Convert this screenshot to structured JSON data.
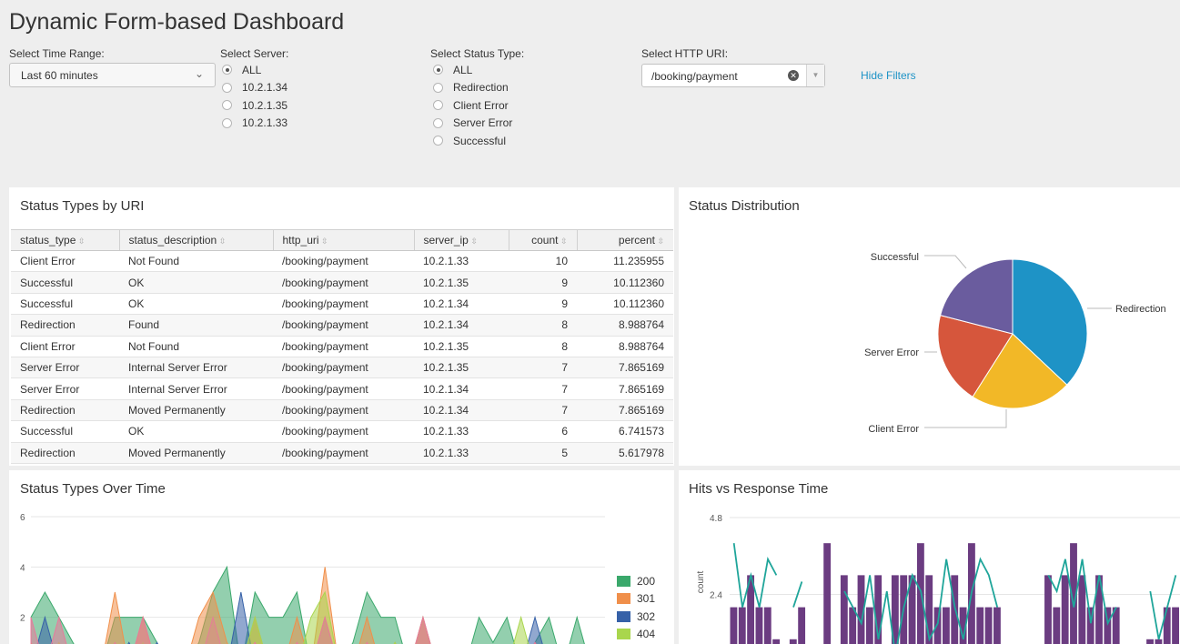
{
  "dashboard": {
    "title": "Dynamic Form-based Dashboard"
  },
  "filters": {
    "time_range": {
      "label": "Select Time Range:",
      "value": "Last 60 minutes"
    },
    "server": {
      "label": "Select Server:",
      "options": [
        "ALL",
        "10.2.1.34",
        "10.2.1.35",
        "10.2.1.33"
      ],
      "selected": 0
    },
    "status_type": {
      "label": "Select Status Type:",
      "options": [
        "ALL",
        "Redirection",
        "Client Error",
        "Server Error",
        "Successful"
      ],
      "selected": 0
    },
    "http_uri": {
      "label": "Select HTTP URI:",
      "value": "/booking/payment"
    },
    "hide_label": "Hide Filters"
  },
  "status_table": {
    "title": "Status Types by URI",
    "columns": [
      "status_type",
      "status_description",
      "http_uri",
      "server_ip",
      "count",
      "percent"
    ],
    "rows": [
      [
        "Client Error",
        "Not Found",
        "/booking/payment",
        "10.2.1.33",
        "10",
        "11.235955"
      ],
      [
        "Successful",
        "OK",
        "/booking/payment",
        "10.2.1.35",
        "9",
        "10.112360"
      ],
      [
        "Successful",
        "OK",
        "/booking/payment",
        "10.2.1.34",
        "9",
        "10.112360"
      ],
      [
        "Redirection",
        "Found",
        "/booking/payment",
        "10.2.1.34",
        "8",
        "8.988764"
      ],
      [
        "Client Error",
        "Not Found",
        "/booking/payment",
        "10.2.1.35",
        "8",
        "8.988764"
      ],
      [
        "Server Error",
        "Internal Server Error",
        "/booking/payment",
        "10.2.1.35",
        "7",
        "7.865169"
      ],
      [
        "Server Error",
        "Internal Server Error",
        "/booking/payment",
        "10.2.1.34",
        "7",
        "7.865169"
      ],
      [
        "Redirection",
        "Moved Permanently",
        "/booking/payment",
        "10.2.1.34",
        "7",
        "7.865169"
      ],
      [
        "Successful",
        "OK",
        "/booking/payment",
        "10.2.1.33",
        "6",
        "6.741573"
      ],
      [
        "Redirection",
        "Moved Permanently",
        "/booking/payment",
        "10.2.1.33",
        "5",
        "5.617978"
      ]
    ]
  },
  "pie": {
    "title": "Status Distribution",
    "chart_data": {
      "type": "pie",
      "slices": [
        {
          "label": "Redirection",
          "value": 37,
          "color": "#1e93c6"
        },
        {
          "label": "Client Error",
          "value": 22,
          "color": "#f2b827"
        },
        {
          "label": "Server Error",
          "value": 20,
          "color": "#d6563c"
        },
        {
          "label": "Successful",
          "value": 21,
          "color": "#6a5c9e"
        }
      ]
    }
  },
  "area_chart": {
    "title": "Status Types Over Time",
    "chart_data": {
      "type": "area",
      "y_ticks": [
        "6",
        "4",
        "2"
      ],
      "ylim": [
        0,
        6
      ],
      "series": [
        {
          "name": "200",
          "color": "#3aa86b",
          "values": [
            2,
            3,
            2,
            1,
            0,
            0,
            2,
            2,
            2,
            1,
            0,
            0,
            1,
            3,
            4,
            0,
            3,
            2,
            2,
            3,
            0,
            2,
            0,
            1,
            3,
            2,
            2,
            0,
            2,
            0,
            0,
            0,
            2,
            1,
            2,
            0,
            1,
            2,
            0,
            2,
            0,
            0
          ]
        },
        {
          "name": "301",
          "color": "#f08f4a",
          "values": [
            1,
            0,
            0,
            0,
            0,
            0,
            3,
            0,
            2,
            0,
            0,
            0,
            2,
            3,
            1,
            0,
            2,
            0,
            0,
            2,
            0,
            4,
            0,
            0,
            2,
            0,
            1,
            0,
            2,
            0,
            0,
            0,
            0,
            0,
            0,
            0,
            1,
            0,
            0,
            0,
            0,
            0
          ]
        },
        {
          "name": "302",
          "color": "#3661a8",
          "values": [
            0,
            2,
            0,
            0,
            0,
            0,
            0,
            1,
            0,
            1,
            0,
            0,
            0,
            0,
            0,
            3,
            0,
            0,
            0,
            0,
            0,
            0,
            0,
            0,
            0,
            0,
            0,
            0,
            0,
            0,
            0,
            0,
            0,
            0,
            0,
            0,
            2,
            0,
            0,
            0,
            0,
            0
          ]
        },
        {
          "name": "404",
          "color": "#a9d64d",
          "values": [
            0,
            0,
            1,
            0,
            0,
            0,
            1,
            0,
            1,
            0,
            0,
            0,
            0,
            2,
            0,
            0,
            2,
            0,
            0,
            0,
            2,
            3,
            0,
            0,
            0,
            0,
            1,
            0,
            0,
            0,
            0,
            0,
            0,
            0,
            0,
            2,
            0,
            0,
            0,
            0,
            0,
            0
          ]
        },
        {
          "name": "",
          "color": "#e87a9b",
          "values": [
            2,
            0,
            2,
            0,
            0,
            0,
            1,
            0,
            2,
            0,
            0,
            0,
            0,
            2,
            0,
            0,
            1,
            0,
            0,
            1,
            0,
            2,
            0,
            0,
            1,
            0,
            0,
            0,
            2,
            0,
            0,
            0,
            0,
            0,
            0,
            0,
            1,
            0,
            0,
            0,
            0,
            0
          ]
        }
      ]
    }
  },
  "combo_chart": {
    "title": "Hits vs Response Time",
    "chart_data": {
      "type": "bar",
      "ylabel": "count",
      "y_ticks": [
        "4.8",
        "2.4"
      ],
      "ylim": [
        0,
        4.8
      ],
      "bar_color": "#6b3c81",
      "line_color": "#1fa59a",
      "bars": [
        2,
        2,
        3,
        2,
        2,
        1,
        0,
        1,
        2,
        0,
        0,
        4,
        0,
        3,
        2,
        3,
        2,
        3,
        0,
        3,
        3,
        3,
        4,
        3,
        2,
        2,
        3,
        2,
        4,
        2,
        2,
        2,
        0,
        0,
        0,
        0,
        0,
        3,
        2,
        3,
        4,
        3,
        2,
        3,
        2,
        2,
        0,
        0,
        0,
        1,
        1,
        2,
        2
      ],
      "line": [
        4,
        2,
        3,
        2,
        3.5,
        3,
        0,
        2,
        2.8,
        0,
        0,
        3.5,
        0,
        2.5,
        2,
        1.5,
        3,
        1,
        2.5,
        0.5,
        2,
        3,
        2.5,
        1,
        1.5,
        3.5,
        2,
        1,
        2.5,
        3.5,
        3,
        2,
        0,
        0,
        0,
        0,
        0,
        3,
        2.5,
        3.5,
        2,
        3.5,
        1.5,
        3,
        1.5,
        2,
        0,
        0,
        0,
        2.5,
        1,
        2,
        3
      ]
    }
  }
}
